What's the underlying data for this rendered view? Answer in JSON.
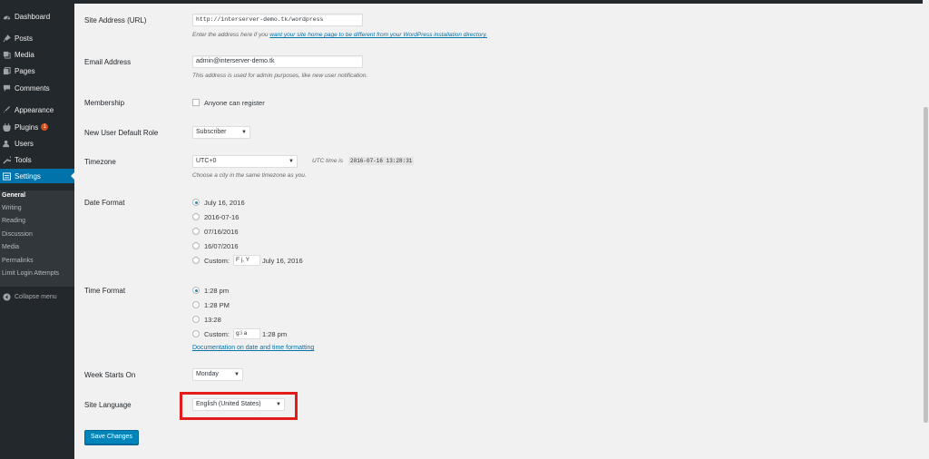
{
  "sidebar": {
    "items": [
      {
        "label": "Dashboard",
        "icon": "dashboard-icon"
      },
      {
        "label": "Posts",
        "icon": "pin-icon"
      },
      {
        "label": "Media",
        "icon": "media-icon"
      },
      {
        "label": "Pages",
        "icon": "pages-icon"
      },
      {
        "label": "Comments",
        "icon": "comments-icon"
      },
      {
        "label": "Appearance",
        "icon": "brush-icon"
      },
      {
        "label": "Plugins",
        "icon": "plugin-icon",
        "badge": "1"
      },
      {
        "label": "Users",
        "icon": "users-icon"
      },
      {
        "label": "Tools",
        "icon": "wrench-icon"
      },
      {
        "label": "Settings",
        "icon": "settings-icon"
      }
    ],
    "submenu": [
      "General",
      "Writing",
      "Reading",
      "Discussion",
      "Media",
      "Permalinks",
      "Limit Login Attempts"
    ],
    "collapse_label": "Collapse menu"
  },
  "form": {
    "site_address": {
      "label": "Site Address (URL)",
      "value": "http://interserver-demo.tk/wordpress",
      "desc_prefix": "Enter the address here if you",
      "desc_link": "want your site home page to be different from your WordPress installation directory."
    },
    "email": {
      "label": "Email Address",
      "value": "admin@interserver-demo.tk",
      "desc": "This address is used for admin purposes, like new user notification."
    },
    "membership": {
      "label": "Membership",
      "checkbox_label": "Anyone can register"
    },
    "default_role": {
      "label": "New User Default Role",
      "value": "Subscriber"
    },
    "timezone": {
      "label": "Timezone",
      "value": "UTC+0",
      "utc_label": "UTC time is",
      "utc_value": "2016-07-16 13:28:31",
      "desc": "Choose a city in the same timezone as you."
    },
    "date_format": {
      "label": "Date Format",
      "options": [
        "July 16, 2016",
        "2016-07-16",
        "07/16/2016",
        "16/07/2016"
      ],
      "custom_label": "Custom:",
      "custom_value": "F j, Y",
      "custom_preview": "July 16, 2016"
    },
    "time_format": {
      "label": "Time Format",
      "options": [
        "1:28 pm",
        "1:28 PM",
        "13:28"
      ],
      "custom_label": "Custom:",
      "custom_value": "g:i a",
      "custom_preview": "1:28 pm",
      "doc_link": "Documentation on date and time formatting"
    },
    "week_start": {
      "label": "Week Starts On",
      "value": "Monday"
    },
    "site_language": {
      "label": "Site Language",
      "value": "English (United States)"
    },
    "save_label": "Save Changes"
  },
  "colors": {
    "sidebar_bg": "#23282d",
    "active": "#0073aa",
    "highlight": "#e21b1b",
    "button": "#0085ba"
  }
}
